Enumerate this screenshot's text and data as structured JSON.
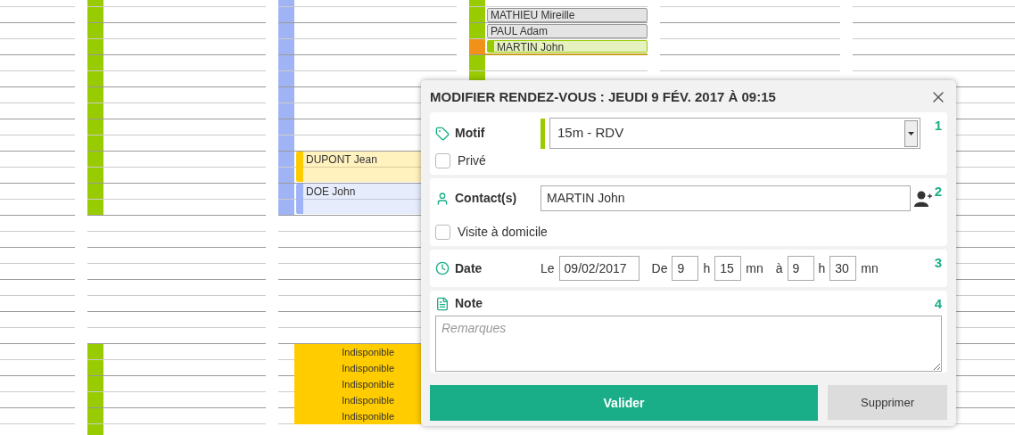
{
  "calendar": {
    "columns": [
      {},
      {
        "color": "#99cc00"
      },
      {
        "color": "#a0b4f5",
        "events": [
          {
            "kind": "appointment",
            "name": "DUPONT Jean",
            "color": "#ffcc00",
            "selected": false
          },
          {
            "kind": "appointment",
            "name": "DOE John",
            "color": "#a0b4f5",
            "selected": false
          },
          {
            "kind": "unavailable",
            "name": "Indisponible"
          },
          {
            "kind": "unavailable",
            "name": "Indisponible"
          },
          {
            "kind": "unavailable",
            "name": "Indisponible"
          },
          {
            "kind": "unavailable",
            "name": "Indisponible"
          },
          {
            "kind": "unavailable",
            "name": "Indisponible"
          }
        ]
      },
      {
        "color": "#99cc00",
        "events": [
          {
            "kind": "appointment",
            "name": "MATHIEU Mireille",
            "color": "#999999",
            "selected": false
          },
          {
            "kind": "appointment",
            "name": "PAUL Adam",
            "color": "#999999",
            "selected": false
          },
          {
            "kind": "appointment",
            "name": "MARTIN John",
            "color": "#99cc00",
            "selected": true
          }
        ]
      },
      {},
      {}
    ]
  },
  "dialog": {
    "title": "MODIFIER RENDEZ-VOUS : JEUDI 9 FÉV. 2017 À 09:15",
    "motif": {
      "label": "Motif",
      "number": "1",
      "value": "15m - RDV",
      "color": "#99cc00",
      "private": {
        "label": "Privé",
        "checked": false
      }
    },
    "contact": {
      "label": "Contact(s)",
      "number": "2",
      "value": "MARTIN John",
      "home_visit": {
        "label": "Visite à domicile",
        "checked": false
      }
    },
    "date": {
      "label": "Date",
      "number": "3",
      "on_label": "Le",
      "date": "09/02/2017",
      "from_label": "De",
      "from_hour": "9",
      "from_hour_unit": "h",
      "from_minute": "15",
      "from_minute_unit": "mn",
      "to_label": "à",
      "to_hour": "9",
      "to_hour_unit": "h",
      "to_minute": "30",
      "to_minute_unit": "mn"
    },
    "note": {
      "label": "Note",
      "number": "4",
      "placeholder": "Remarques"
    },
    "buttons": {
      "validate": "Valider",
      "delete": "Supprimer"
    }
  }
}
